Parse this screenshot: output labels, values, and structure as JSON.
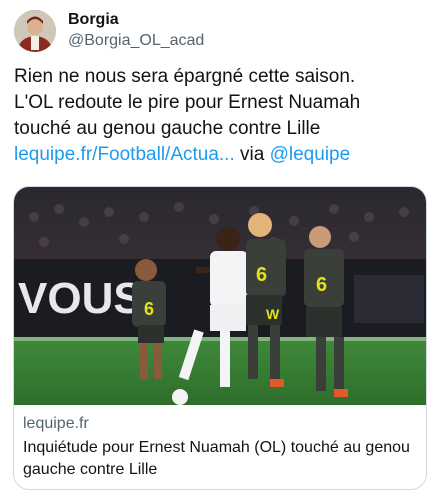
{
  "author": {
    "name": "Borgia",
    "handle": "@Borgia_OL_acad",
    "avatar_icon": "avatar-portrait"
  },
  "tweet": {
    "line1": "Rien ne nous sera épargné cette saison.",
    "line2": "L'OL redoute le pire pour Ernest Nuamah",
    "line3": "touché au genou gauche contre Lille",
    "link_text": "lequipe.fr/Football/Actua...",
    "via_text": "via",
    "mention": "@lequipe"
  },
  "card": {
    "image_icon": "football-match-photo",
    "banner_text": "VOUS",
    "domain": "lequipe.fr",
    "title": "Inquiétude pour Ernest Nuamah (OL) touché au genou gauche contre Lille"
  },
  "colors": {
    "link": "#1d9bf0",
    "secondary_text": "#536471",
    "border": "#cfd9de",
    "lille_kit": "#3a3f3a",
    "lille_accent": "#e0e21a",
    "lyon_kit": "#ffffff"
  }
}
